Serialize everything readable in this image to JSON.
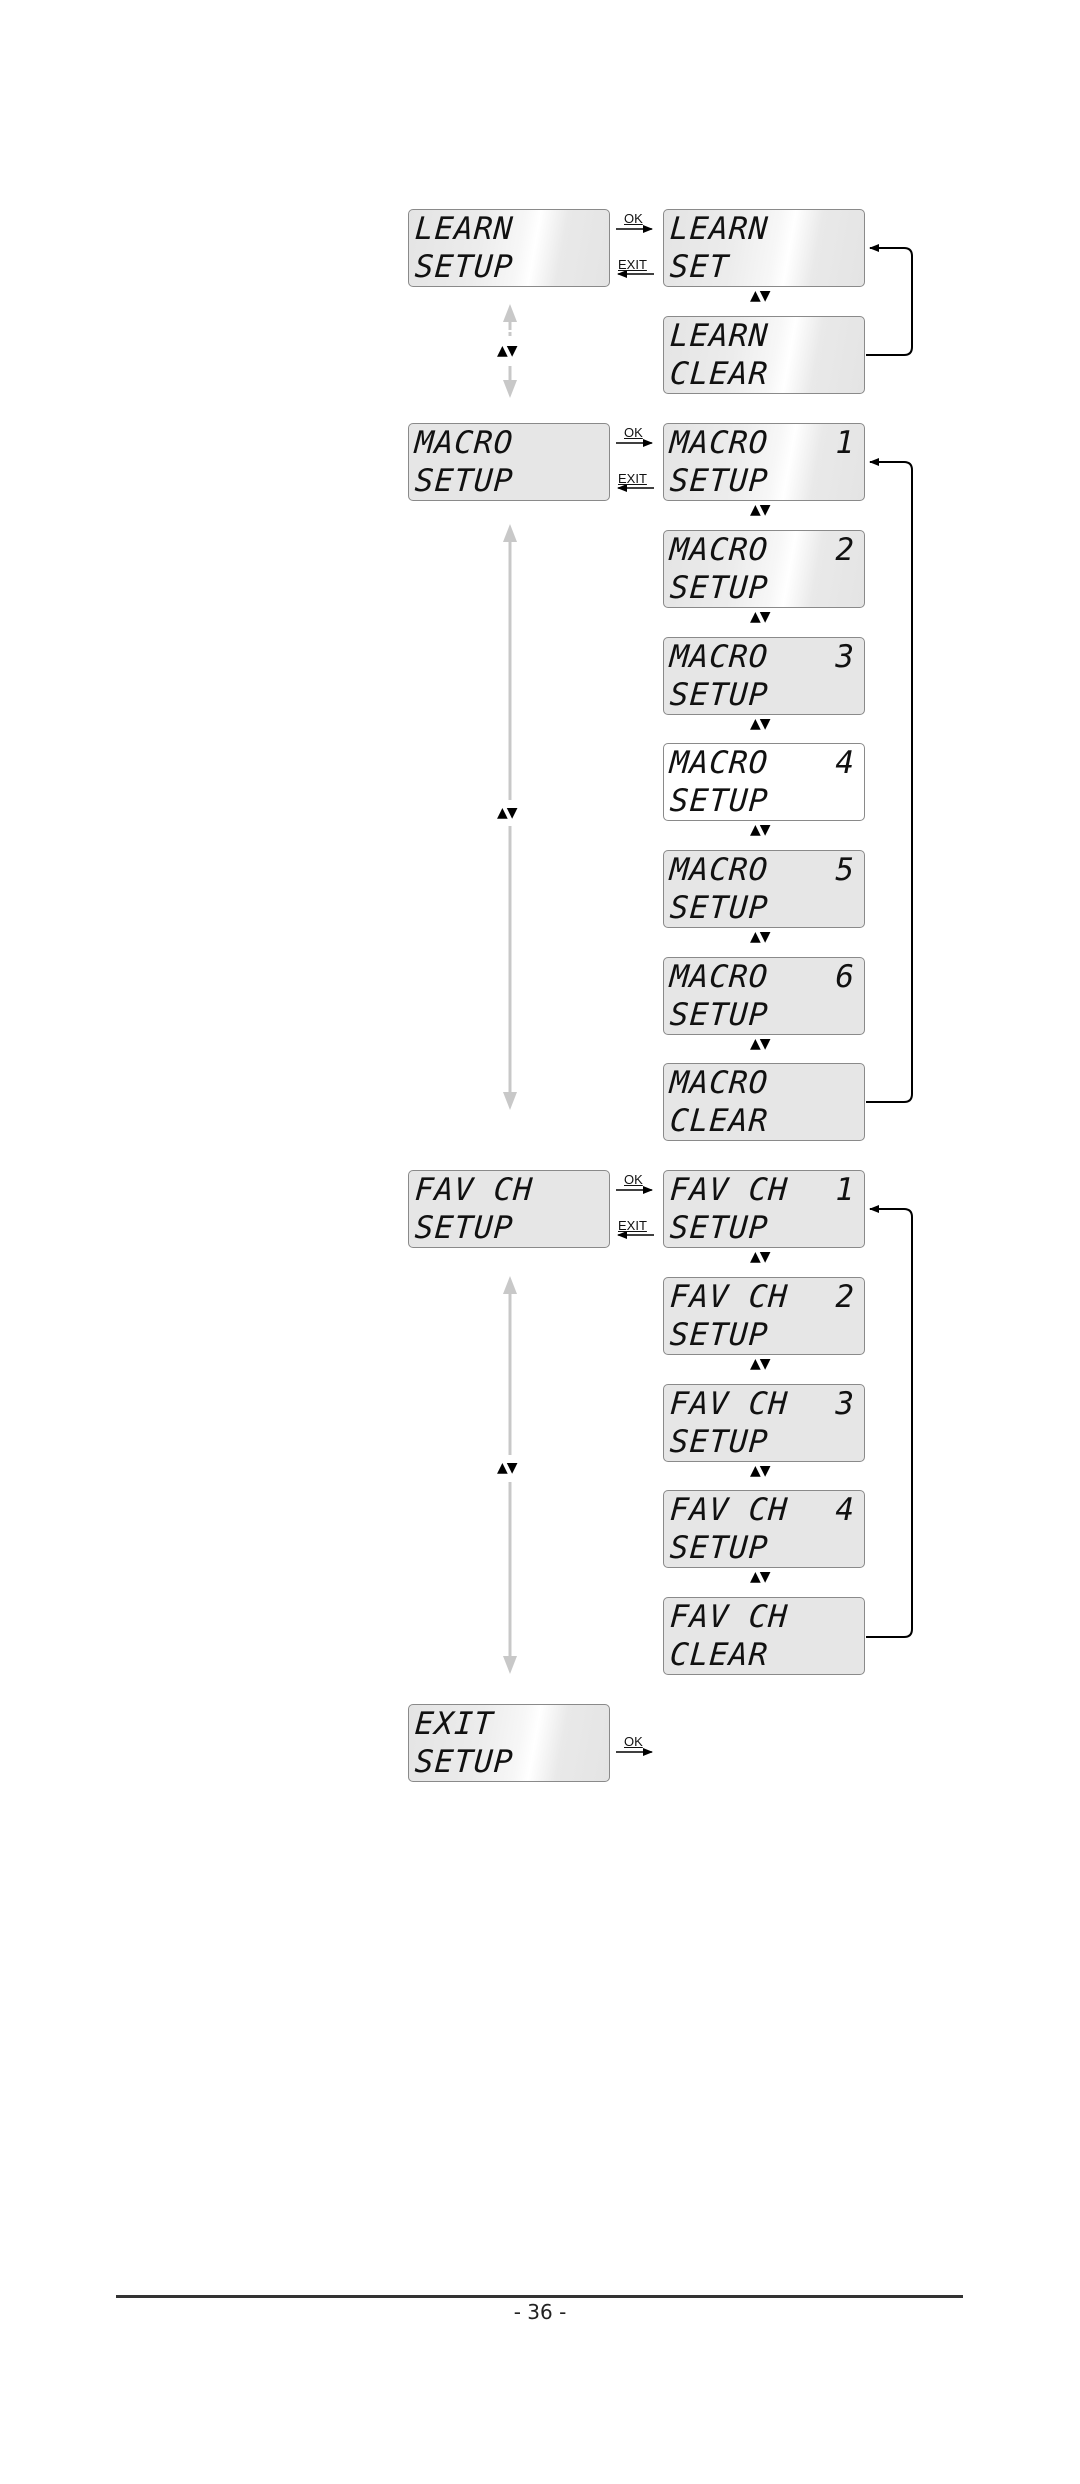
{
  "menu": {
    "learn": {
      "main": {
        "line1": "LEARN",
        "line2": "SETUP"
      },
      "sub": [
        {
          "line1": "LEARN",
          "line2": "SET",
          "num": ""
        },
        {
          "line1": "LEARN",
          "line2": "CLEAR",
          "num": ""
        }
      ]
    },
    "macro": {
      "main": {
        "line1": "MACRO",
        "line2": "SETUP"
      },
      "sub": [
        {
          "line1": "MACRO",
          "line2": "SETUP",
          "num": "1"
        },
        {
          "line1": "MACRO",
          "line2": "SETUP",
          "num": "2"
        },
        {
          "line1": "MACRO",
          "line2": "SETUP",
          "num": "3"
        },
        {
          "line1": "MACRO",
          "line2": "SETUP",
          "num": "4"
        },
        {
          "line1": "MACRO",
          "line2": "SETUP",
          "num": "5"
        },
        {
          "line1": "MACRO",
          "line2": "SETUP",
          "num": "6"
        },
        {
          "line1": "MACRO",
          "line2": "CLEAR",
          "num": ""
        }
      ]
    },
    "favch": {
      "main": {
        "line1": "FAV CH",
        "line2": "SETUP"
      },
      "sub": [
        {
          "line1": "FAV CH",
          "line2": "SETUP",
          "num": "1"
        },
        {
          "line1": "FAV CH",
          "line2": "SETUP",
          "num": "2"
        },
        {
          "line1": "FAV CH",
          "line2": "SETUP",
          "num": "3"
        },
        {
          "line1": "FAV CH",
          "line2": "SETUP",
          "num": "4"
        },
        {
          "line1": "FAV CH",
          "line2": "CLEAR",
          "num": ""
        }
      ]
    },
    "exit": {
      "main": {
        "line1": "EXIT",
        "line2": "SETUP"
      }
    }
  },
  "labels": {
    "ok": "OK",
    "exit": "EXIT",
    "updown": "▲▼"
  },
  "footer": {
    "page_number": "- 36 -"
  }
}
